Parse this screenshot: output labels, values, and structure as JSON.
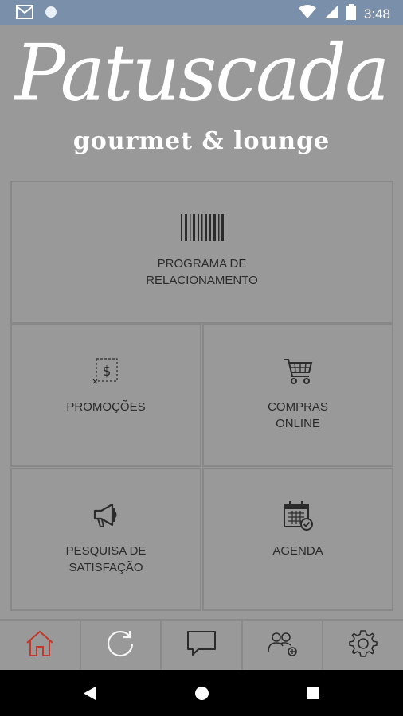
{
  "status_bar": {
    "time": "3:48",
    "icons": [
      "gmail-icon",
      "circle-icon",
      "wifi-icon",
      "signal-icon",
      "battery-icon"
    ]
  },
  "logo": {
    "title": "Patuscada",
    "subtitle": "gourmet & lounge"
  },
  "tiles": {
    "loyalty": {
      "line1": "PROGRAMA DE",
      "line2": "RELACIONAMENTO",
      "icon": "barcode-icon"
    },
    "promotions": {
      "line1": "PROMOÇÕES",
      "icon": "coupon-icon"
    },
    "shopping": {
      "line1": "COMPRAS",
      "line2": "ONLINE",
      "icon": "cart-icon"
    },
    "survey": {
      "line1": "PESQUISA DE",
      "line2": "SATISFAÇÃO",
      "icon": "megaphone-icon"
    },
    "agenda": {
      "line1": "AGENDA",
      "icon": "calendar-icon"
    }
  },
  "bottom_nav": {
    "items": [
      "home-icon",
      "refresh-icon",
      "chat-icon",
      "users-icon",
      "settings-icon"
    ],
    "active": "home-icon",
    "active_color": "#c0392b"
  },
  "colors": {
    "background": "#999999",
    "status_bar": "#7a90aa",
    "text": "#2b2b2b"
  }
}
